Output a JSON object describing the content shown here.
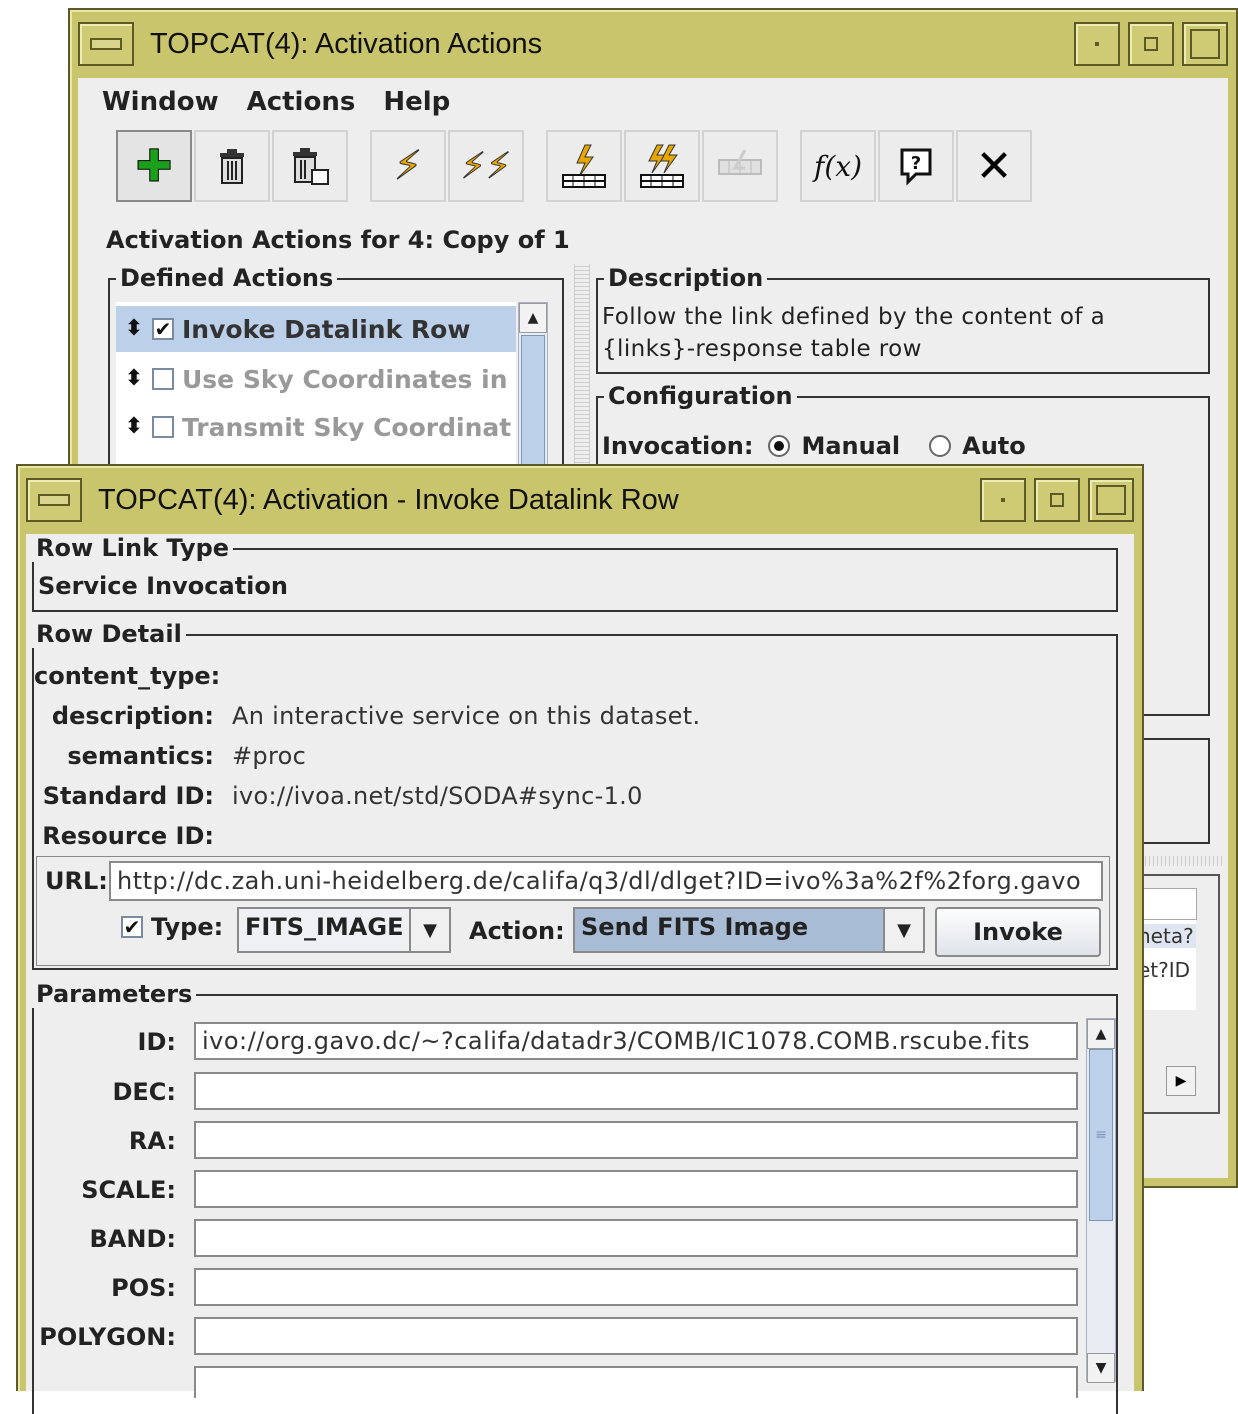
{
  "back_window": {
    "title": "TOPCAT(4): Activation Actions",
    "menu": [
      "Window",
      "Actions",
      "Help"
    ],
    "toolbar": [
      {
        "icon": "add-icon",
        "glyph": "✚"
      },
      {
        "icon": "delete-icon",
        "glyph": "🗑"
      },
      {
        "icon": "delete-all-icon",
        "glyph": "🗑"
      },
      {
        "icon": "invoke-icon",
        "glyph": "⚡"
      },
      {
        "icon": "invoke-all-icon",
        "glyph": "⚡"
      },
      {
        "icon": "invoke-row-icon",
        "glyph": "⚡"
      },
      {
        "icon": "invoke-all-rows-icon",
        "glyph": "⚡"
      },
      {
        "icon": "disabled-icon",
        "glyph": "▦"
      },
      {
        "icon": "function-icon",
        "glyph": "f(x)"
      },
      {
        "icon": "help-icon",
        "glyph": "?"
      },
      {
        "icon": "close-icon",
        "glyph": "✕"
      }
    ],
    "heading": "Activation Actions for 4: Copy of 1",
    "defined_actions": {
      "title": "Defined Actions",
      "items": [
        {
          "label": "Invoke Datalink Row",
          "checked": "✔"
        },
        {
          "label": "Use Sky Coordinates in",
          "checked": ""
        },
        {
          "label": "Transmit Sky Coordinat",
          "checked": ""
        }
      ]
    },
    "description": {
      "title": "Description",
      "line1": "Follow the link defined by the content of a",
      "line2": "{links}-response table row"
    },
    "configuration": {
      "title": "Configuration",
      "invocation_label": "Invocation:",
      "manual": "Manual",
      "auto": "Auto"
    },
    "peek_cells": [
      "neta?",
      "et?ID"
    ]
  },
  "front_window": {
    "title": "TOPCAT(4): Activation - Invoke Datalink Row",
    "row_link_type": {
      "title": "Row Link Type",
      "value": "Service Invocation"
    },
    "row_detail": {
      "title": "Row Detail",
      "content_type_label": "content_type:",
      "content_type_value": "",
      "description_label": "description:",
      "description_value": "An interactive service on this dataset.",
      "semantics_label": "semantics:",
      "semantics_value": "#proc",
      "standard_id_label": "Standard ID:",
      "standard_id_value": "ivo://ivoa.net/std/SODA#sync-1.0",
      "resource_id_label": "Resource ID:",
      "resource_id_value": ""
    },
    "url": {
      "label": "URL:",
      "value": "http://dc.zah.uni-heidelberg.de/califa/q3/dl/dlget?ID=ivo%3a%2f%2forg.gavo"
    },
    "type": {
      "checked": "✔",
      "label": "Type:",
      "value": "FITS_IMAGE"
    },
    "action": {
      "label": "Action:",
      "value": "Send FITS Image"
    },
    "invoke_label": "Invoke",
    "parameters": {
      "title": "Parameters",
      "rows": [
        {
          "label": "ID:",
          "value": "ivo://org.gavo.dc/~?califa/datadr3/COMB/IC1078.COMB.rscube.fits"
        },
        {
          "label": "DEC:",
          "value": ""
        },
        {
          "label": "RA:",
          "value": ""
        },
        {
          "label": "SCALE:",
          "value": ""
        },
        {
          "label": "BAND:",
          "value": ""
        },
        {
          "label": "POS:",
          "value": ""
        },
        {
          "label": "POLYGON:",
          "value": ""
        }
      ]
    }
  },
  "colors": {
    "frame": "#c9c56c",
    "frame_dark": "#5e5a28",
    "client_bg": "#eeeeee",
    "selection": "#bcd0ea"
  }
}
